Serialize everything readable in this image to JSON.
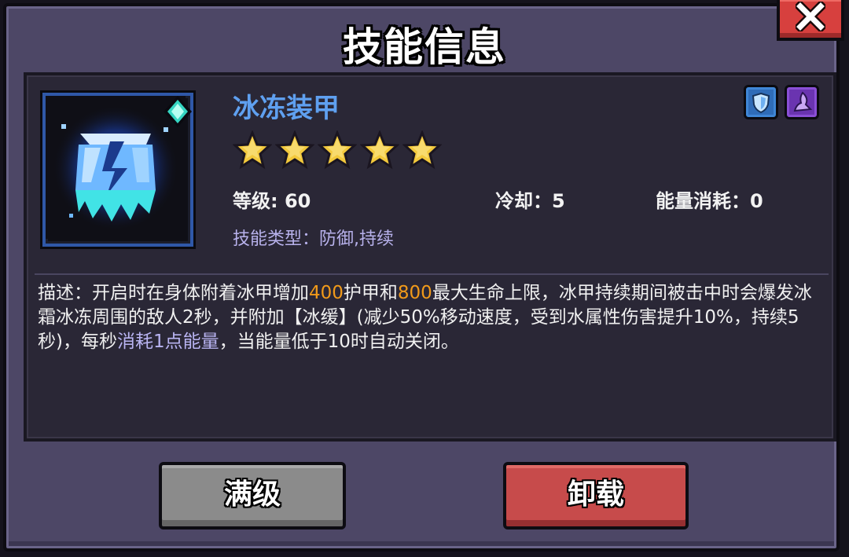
{
  "window": {
    "title": "技能信息"
  },
  "skill": {
    "name": "冰冻装甲",
    "stars": 5,
    "level_label": "等级: 60",
    "cooldown_label": "冷却：5",
    "energy_label": "能量消耗：0",
    "type_label": "技能类型：防御,持续",
    "icon": "ice-armor-icon"
  },
  "tags": [
    "shield-tag-icon",
    "magic-tag-icon"
  ],
  "description": {
    "p1": "描述：开启时在身体附着冰甲增加",
    "v1": "400",
    "p2": "护甲和",
    "v2": "800",
    "p3": "最大生命上限，冰甲持续期间被击中时会爆发冰霜冰冻周围的敌人2秒，并附加【冰缓】(减少50%移动速度，受到水属性伤害提升10%，持续5秒)，每秒",
    "v3": "消耗1点能量",
    "p4": "，当能量低于10时自动关闭。"
  },
  "buttons": {
    "max_level": "满级",
    "unload": "卸载"
  },
  "colors": {
    "panel": "#4d4766",
    "inner": "#2a2736",
    "name": "#5fa0f0",
    "highlight": "#f19a1a",
    "accent_purple": "#b9b4f2",
    "close": "#d7403e"
  }
}
